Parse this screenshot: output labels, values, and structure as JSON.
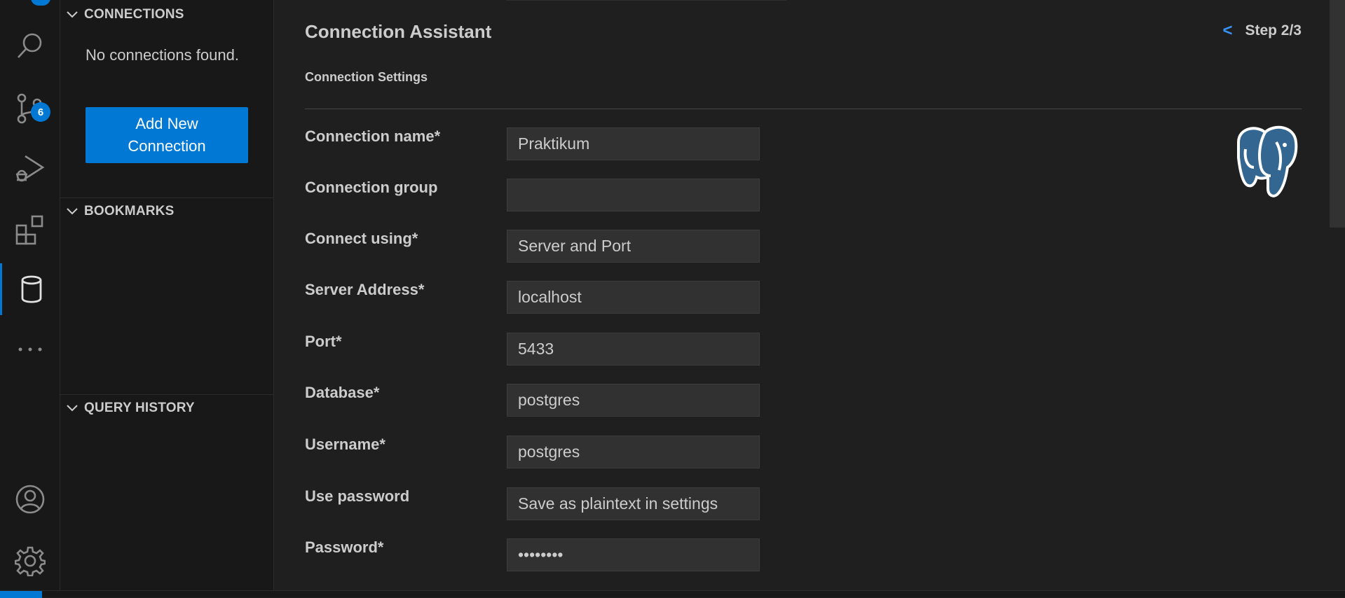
{
  "activity_bar": {
    "items": [
      {
        "icon": "search-icon"
      },
      {
        "icon": "source-control-icon",
        "badge": "6"
      },
      {
        "icon": "run-debug-icon"
      },
      {
        "icon": "extensions-icon"
      },
      {
        "icon": "database-icon",
        "active": true
      },
      {
        "icon": "more-icon"
      }
    ],
    "bottom": [
      {
        "icon": "account-icon"
      },
      {
        "icon": "settings-gear-icon"
      }
    ]
  },
  "sidebar": {
    "connections": {
      "title": "CONNECTIONS",
      "empty_text": "No connections found.",
      "add_button": "Add New Connection"
    },
    "bookmarks": {
      "title": "BOOKMARKS"
    },
    "query_history": {
      "title": "QUERY HISTORY"
    }
  },
  "main": {
    "title": "Connection Assistant",
    "step_back": "<",
    "step": "Step 2/3",
    "section": "Connection Settings",
    "logo_icon": "postgresql-elephant-icon",
    "fields": [
      {
        "label": "Connection name*",
        "value": "Praktikum"
      },
      {
        "label": "Connection group",
        "value": ""
      },
      {
        "label": "Connect using*",
        "value": "Server and Port"
      },
      {
        "label": "Server Address*",
        "value": "localhost"
      },
      {
        "label": "Port*",
        "value": "5433"
      },
      {
        "label": "Database*",
        "value": "postgres"
      },
      {
        "label": "Username*",
        "value": "postgres"
      },
      {
        "label": "Use password",
        "value": "Save as plaintext in settings"
      },
      {
        "label": "Password*",
        "value": "••••••••"
      }
    ]
  },
  "colors": {
    "accent": "#0078d4",
    "link": "#3794ff",
    "background": "#1f1f1f",
    "sidebar": "#181818",
    "input": "#313131",
    "text": "#cccccc"
  }
}
